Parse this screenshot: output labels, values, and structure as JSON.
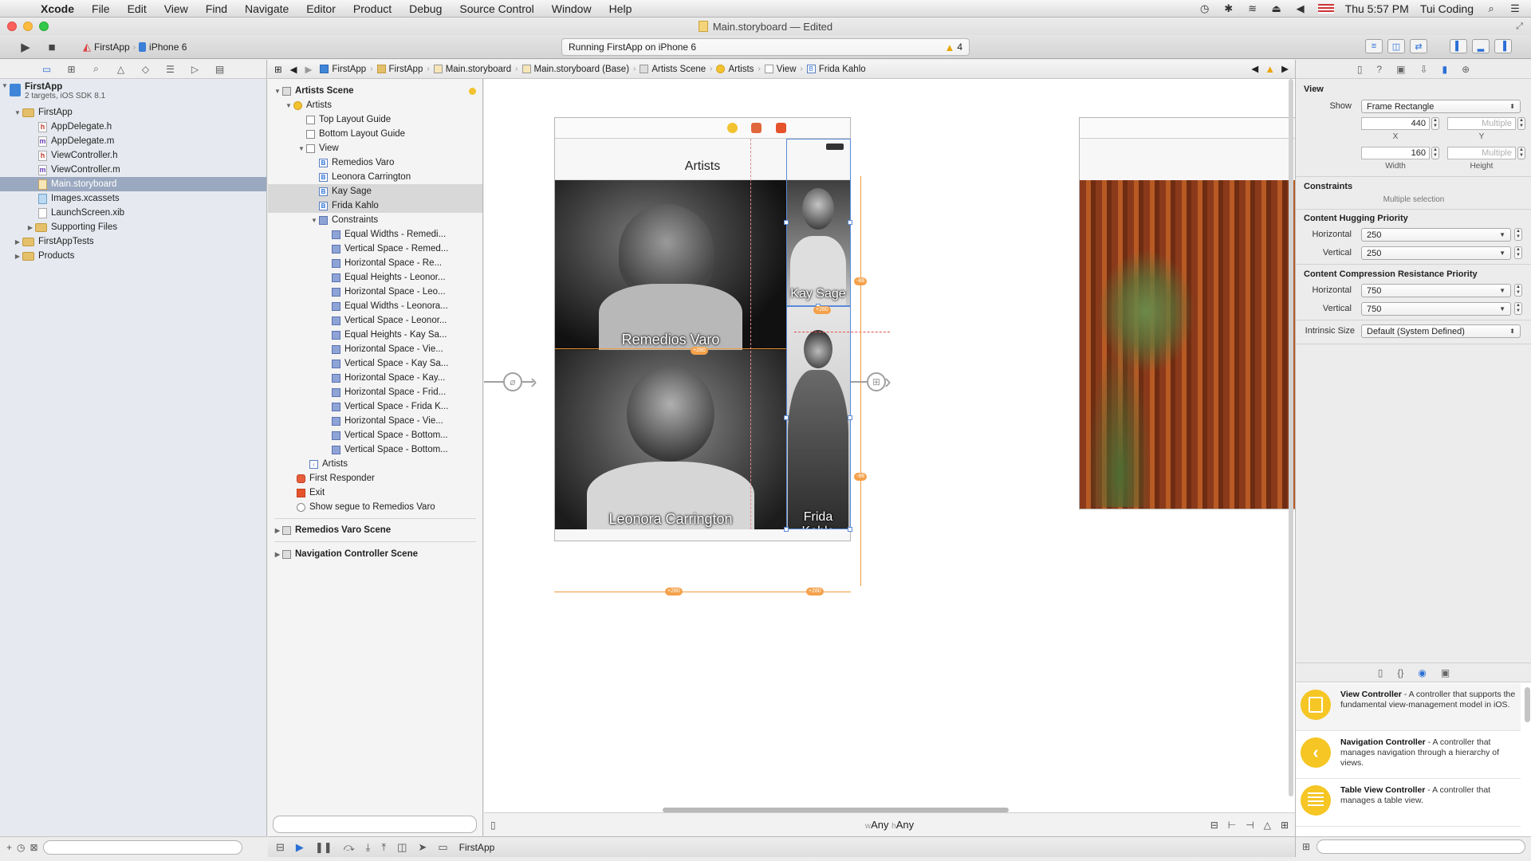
{
  "menubar": {
    "app_name": "Xcode",
    "items": [
      "File",
      "Edit",
      "View",
      "Find",
      "Navigate",
      "Editor",
      "Product",
      "Debug",
      "Source Control",
      "Window",
      "Help"
    ],
    "clock": "Thu 5:57 PM",
    "user": "Tui Coding"
  },
  "window": {
    "title": "Main.storyboard — Edited"
  },
  "toolbar": {
    "scheme_target": "FirstApp",
    "scheme_device": "iPhone 6",
    "activity_text": "Running FirstApp on iPhone 6",
    "warning_count": "4"
  },
  "navigator": {
    "project_name": "FirstApp",
    "project_subtitle": "2 targets, iOS SDK 8.1",
    "items": [
      {
        "label": "FirstApp",
        "kind": "group"
      },
      {
        "label": "AppDelegate.h",
        "kind": "h"
      },
      {
        "label": "AppDelegate.m",
        "kind": "m"
      },
      {
        "label": "ViewController.h",
        "kind": "h"
      },
      {
        "label": "ViewController.m",
        "kind": "m"
      },
      {
        "label": "Main.storyboard",
        "kind": "storyboard",
        "selected": true
      },
      {
        "label": "Images.xcassets",
        "kind": "xcassets"
      },
      {
        "label": "LaunchScreen.xib",
        "kind": "xib"
      },
      {
        "label": "Supporting Files",
        "kind": "group"
      },
      {
        "label": "FirstAppTests",
        "kind": "group"
      },
      {
        "label": "Products",
        "kind": "group"
      }
    ]
  },
  "jumpbar": {
    "crumbs": [
      "FirstApp",
      "FirstApp",
      "Main.storyboard",
      "Main.storyboard (Base)",
      "Artists Scene",
      "Artists",
      "View",
      "Frida Kahlo"
    ]
  },
  "outline": {
    "scene_title": "Artists Scene",
    "vc_label": "Artists",
    "top_guide": "Top Layout Guide",
    "bottom_guide": "Bottom Layout Guide",
    "view_label": "View",
    "labels": [
      "Remedios Varo",
      "Leonora Carrington",
      "Kay Sage",
      "Frida Kahlo"
    ],
    "constraints_label": "Constraints",
    "constraints": [
      "Equal Widths - Remedi...",
      "Vertical Space - Remed...",
      "Horizontal Space - Re...",
      "Equal Heights - Leonor...",
      "Horizontal Space - Leo...",
      "Equal Widths - Leonora...",
      "Vertical Space - Leonor...",
      "Equal Heights - Kay Sa...",
      "Horizontal Space - Vie...",
      "Vertical Space - Kay Sa...",
      "Horizontal Space - Kay...",
      "Horizontal Space - Frid...",
      "Vertical Space - Frida K...",
      "Horizontal Space - Vie...",
      "Vertical Space - Bottom...",
      "Vertical Space - Bottom..."
    ],
    "nav_item": "Artists",
    "first_responder": "First Responder",
    "exit": "Exit",
    "segue": "Show segue to Remedios Varo",
    "other_scenes": [
      "Remedios Varo Scene",
      "Navigation Controller Scene"
    ]
  },
  "canvas": {
    "nav_title": "Artists",
    "photos": [
      "Remedios Varo",
      "Leonora Carrington",
      "Kay Sage",
      "Frida Kahlo"
    ],
    "size_class_w": "Any",
    "size_class_h": "Any",
    "constraint_badges": [
      "+280",
      "+280",
      "+280",
      "-88",
      "-88",
      "+280"
    ]
  },
  "debug": {
    "target": "FirstApp"
  },
  "inspector": {
    "section": "View",
    "show_label": "Show",
    "show_value": "Frame Rectangle",
    "x_value": "440",
    "y_placeholder": "Multiple",
    "x_label": "X",
    "y_label": "Y",
    "width_value": "160",
    "height_placeholder": "Multiple",
    "width_label": "Width",
    "height_label": "Height",
    "constraints_head": "Constraints",
    "constraints_sub": "Multiple selection",
    "hugging_head": "Content Hugging Priority",
    "horizontal_label": "Horizontal",
    "vertical_label": "Vertical",
    "hugging_h": "250",
    "hugging_v": "250",
    "compression_head": "Content Compression Resistance Priority",
    "compression_h": "750",
    "compression_v": "750",
    "intrinsic_label": "Intrinsic Size",
    "intrinsic_value": "Default (System Defined)"
  },
  "library": {
    "items": [
      {
        "title": "View Controller",
        "desc": " - A controller that supports the fundamental view-management model in iOS."
      },
      {
        "title": "Navigation Controller",
        "desc": " - A controller that manages navigation through a hierarchy of views."
      },
      {
        "title": "Table View Controller",
        "desc": " - A controller that manages a table view."
      }
    ]
  }
}
